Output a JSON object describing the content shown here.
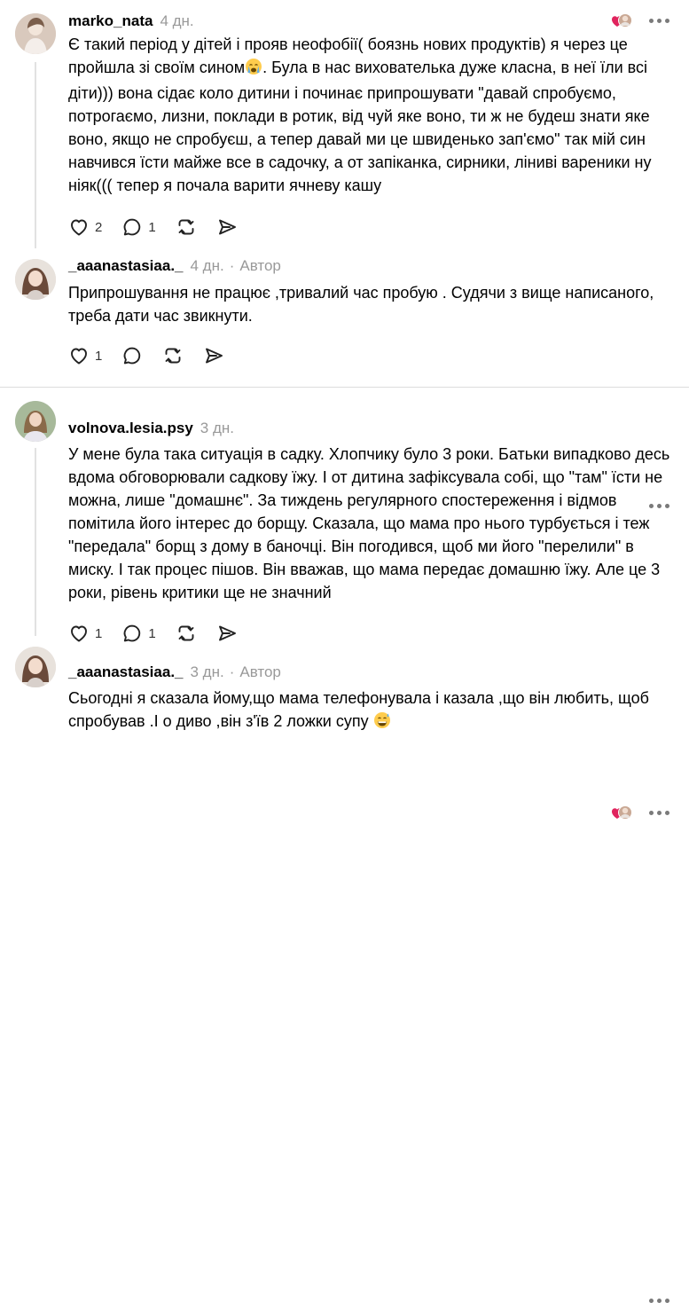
{
  "comments": [
    {
      "user": "marko_nata",
      "time": "4 дн.",
      "text_before_emoji": "Є такий період у дітей і прояв неофобії( боязнь нових продуктів) я через це пройшла зі своїм сином",
      "text_after_emoji": ". Була в нас вихователька дуже класна, в неї їли всі діти))) вона сідає коло дитини і починає припрошувати \"давай спробуємо, потрогаємо, лизни, поклади в ротик, від чуй яке воно, ти ж не будеш знати яке воно, якщо не спробуєш, а тепер давай ми це швиденько зап'ємо\" так мій син навчився їсти майже все в садочку, а от запіканка, сирники, ліниві вареники ну ніяк((( тепер я почала варити ячневу кашу",
      "likes": "2",
      "replies": "1"
    },
    {
      "user": "_aaanastasiaa._",
      "time": "4 дн.",
      "badge": "Автор",
      "text": "Припрошування не працює ,тривалий час пробую . Судячи з вище написаного, треба дати час звикнути.",
      "likes": "1"
    },
    {
      "user": "volnova.lesia.psy",
      "time": "3 дн.",
      "text": "У мене була така ситуація в садку. Хлопчику було 3 роки. Батьки випадково десь вдома обговорювали садкову їжу. І от дитина зафіксувала собі, що \"там\" їсти не можна, лише \"домашнє\". За тиждень регулярного спостереження і відмов помітила його інтерес до борщу. Сказала, що мама про нього турбується і теж \"передала\" борщ з дому в баночці. Він погодився, щоб ми його \"перелили\" в миску. І так процес пішов. Він вважав, що мама передає домашню їжу. Але це 3 роки, рівень критики ще не значний",
      "likes": "1",
      "replies": "1"
    },
    {
      "user": "_aaanastasiaa._",
      "time": "3 дн.",
      "badge": "Автор",
      "text_before_emoji": "Сьогодні я сказала йому,що мама телефонувала і казала ,що він любить, щоб спробував .І о диво ,він з'їв 2 ложки супу",
      "text_after_emoji": ""
    }
  ],
  "icons": [
    "heart-icon",
    "comment-icon",
    "repost-icon",
    "share-icon",
    "more-icon",
    "liked-by-author-icon",
    "crying-emoji-icon",
    "grinning-sweat-emoji-icon"
  ],
  "colors": {
    "muted": "#999999",
    "divider": "#dcdcdc",
    "heart": "#e0245e"
  }
}
